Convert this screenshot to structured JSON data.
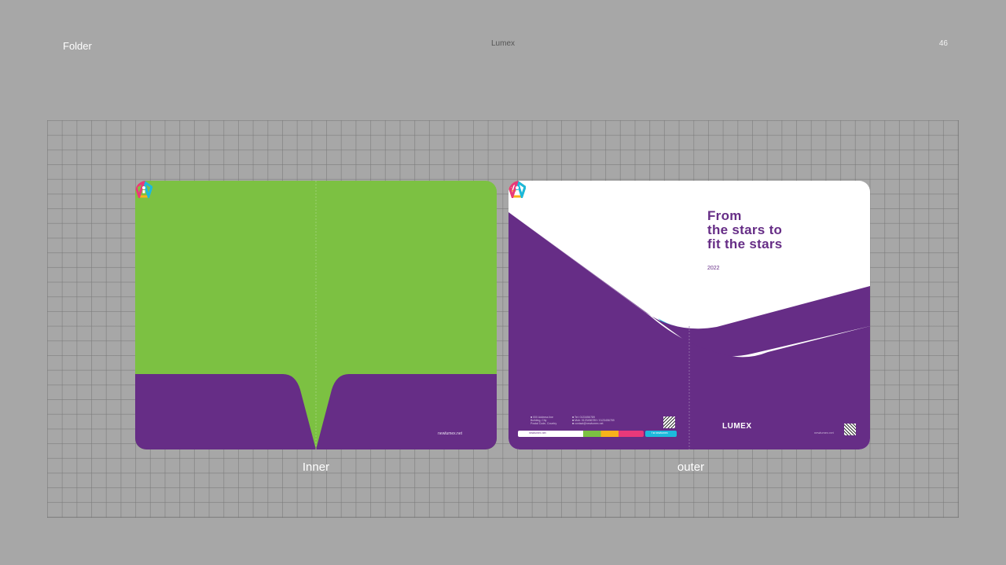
{
  "header": {
    "left": "Folder",
    "center": "Lumex",
    "right": "46"
  },
  "colors": {
    "background": "#a7a7a7",
    "green": "#7cc142",
    "purple": "#662d86",
    "cyan": "#1cb9dc",
    "white": "#ffffff"
  },
  "inner_panel": {
    "caption": "Inner",
    "url": "newlumex.net"
  },
  "outer_panel": {
    "caption": "outer",
    "headline": [
      "From",
      "the stars to",
      "fit the stars"
    ],
    "year": "2022",
    "brand": "LUMEX",
    "url": "newlumex.net",
    "contact_col1": [
      "■ 000 Address line",
      "Building, City",
      "Postal Code, Country"
    ],
    "contact_col2": [
      "■ Tel: 0123456789",
      "■ Mob: 0123456789 / 0123456789",
      "■ contact@newlumex.net"
    ],
    "bar_text": "newlumex.net",
    "button_text": "f ◘ newlumex"
  }
}
